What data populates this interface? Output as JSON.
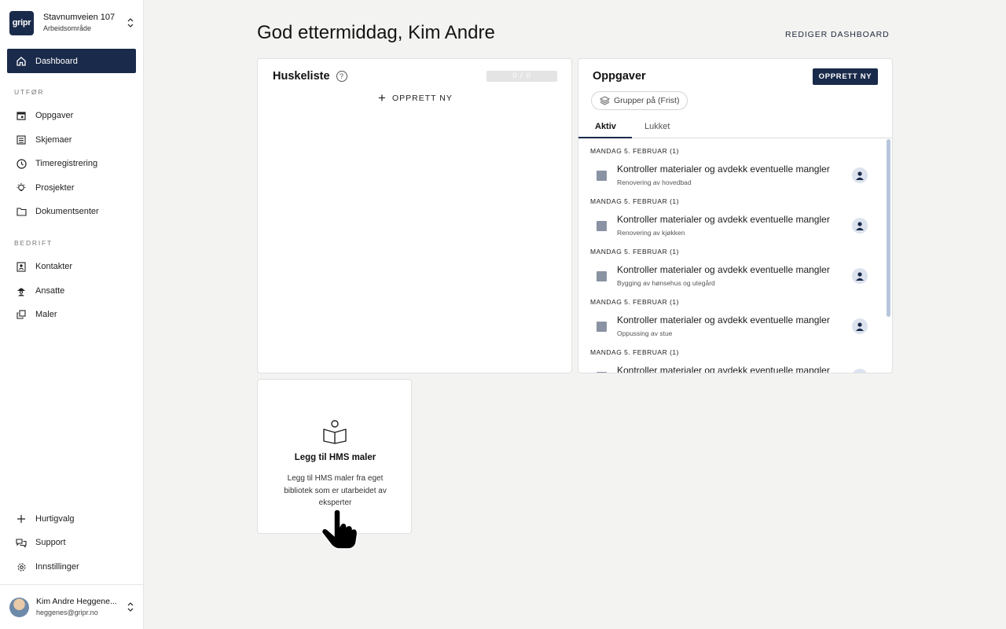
{
  "workspace": {
    "logo": "gripr",
    "name": "Stavnumveien 107",
    "subtitle": "Arbeidsområde"
  },
  "nav": {
    "active": {
      "label": "Dashboard",
      "icon": "home-icon"
    },
    "sections": [
      {
        "title": "UTFØR",
        "items": [
          {
            "label": "Oppgaver",
            "icon": "calendar-icon"
          },
          {
            "label": "Skjemaer",
            "icon": "list-icon"
          },
          {
            "label": "Timeregistrering",
            "icon": "clock-icon"
          },
          {
            "label": "Prosjekter",
            "icon": "lightbulb-icon"
          },
          {
            "label": "Dokumentsenter",
            "icon": "folder-icon"
          }
        ]
      },
      {
        "title": "BEDRIFT",
        "items": [
          {
            "label": "Kontakter",
            "icon": "contact-icon"
          },
          {
            "label": "Ansatte",
            "icon": "worker-icon"
          },
          {
            "label": "Maler",
            "icon": "copy-icon"
          }
        ]
      }
    ],
    "bottom": [
      {
        "label": "Hurtigvalg",
        "icon": "plus-icon"
      },
      {
        "label": "Support",
        "icon": "chat-icon"
      },
      {
        "label": "Innstillinger",
        "icon": "gear-icon"
      }
    ]
  },
  "user": {
    "name": "Kim Andre Heggene...",
    "email": "heggenes@gripr.no"
  },
  "header": {
    "greeting": "God ettermiddag, Kim Andre",
    "edit_label": "REDIGER DASHBOARD"
  },
  "huskeliste": {
    "title": "Huskeliste",
    "help": "?",
    "progress": "0 / 0",
    "create_label": "OPPRETT NY"
  },
  "oppgaver": {
    "title": "Oppgaver",
    "create_label": "OPPRETT NY",
    "group_label": "Grupper på (Frist)",
    "tabs": [
      "Aktiv",
      "Lukket"
    ],
    "active_tab": "Aktiv",
    "groups": [
      {
        "date": "MANDAG 5. FEBRUAR (1)",
        "title": "Kontroller materialer og avdekk eventuelle mangler",
        "project": "Renovering av hovedbad"
      },
      {
        "date": "MANDAG 5. FEBRUAR (1)",
        "title": "Kontroller materialer og avdekk eventuelle mangler",
        "project": "Renovering av kjøkken"
      },
      {
        "date": "MANDAG 5. FEBRUAR (1)",
        "title": "Kontroller materialer og avdekk eventuelle mangler",
        "project": "Bygging av hønsehus og utegård"
      },
      {
        "date": "MANDAG 5. FEBRUAR (1)",
        "title": "Kontroller materialer og avdekk eventuelle mangler",
        "project": "Oppussing av stue"
      },
      {
        "date": "MANDAG 5. FEBRUAR (1)",
        "title": "Kontroller materialer og avdekk eventuelle mangler",
        "project": ""
      }
    ]
  },
  "hms": {
    "title": "Legg til HMS maler",
    "description": "Legg til HMS maler fra eget bibliotek som er utarbeidet av eksperter",
    "icon": "reader-book-icon"
  },
  "colors": {
    "primary": "#1a2a4a",
    "background": "#f3f3f2",
    "checkbox": "#8a93a3"
  }
}
